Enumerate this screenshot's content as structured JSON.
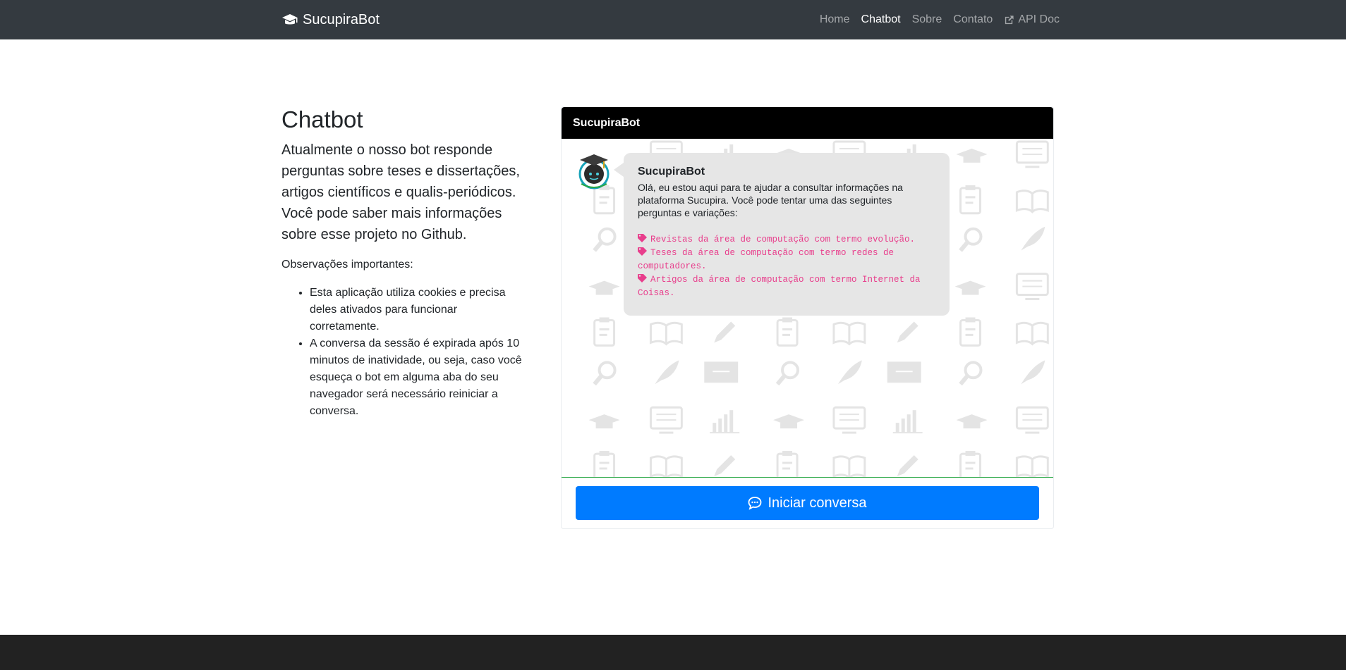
{
  "navbar": {
    "brand": "SucupiraBot",
    "items": [
      {
        "label": "Home",
        "active": false
      },
      {
        "label": "Chatbot",
        "active": true
      },
      {
        "label": "Sobre",
        "active": false
      },
      {
        "label": "Contato",
        "active": false
      },
      {
        "label": "API Doc",
        "active": false,
        "icon": "external-link-icon"
      }
    ]
  },
  "intro": {
    "title": "Chatbot",
    "lead": "Atualmente o nosso bot responde perguntas sobre teses e dissertações, artigos científicos e qualis-periódicos. Você pode saber mais informações sobre esse projeto no Github.",
    "notes_title": "Observações importantes:",
    "notes": [
      "Esta aplicação utiliza cookies e precisa deles ativados para funcionar corretamente.",
      "A conversa da sessão é expirada após 10 minutos de inatividade, ou seja, caso você esqueça o bot em alguma aba do seu navegador será necessário reiniciar a conversa."
    ]
  },
  "chat": {
    "header": "SucupiraBot",
    "message": {
      "sender": "SucupiraBot",
      "text": "Olá, eu estou aqui para te ajudar a consultar informações na plataforma Sucupira. Você pode tentar uma das seguintes perguntas e variações:",
      "suggestions": [
        "Revistas da área de computação com termo evolução.",
        "Teses da área de computação com termo redes de computadores.",
        "Artigos da área de computação com termo Internet da Coisas."
      ]
    },
    "start_button": "Iniciar conversa"
  },
  "colors": {
    "navbar": "#343a40",
    "primary": "#007bff",
    "suggestion": "#e83e8c",
    "bubble": "#e6e6e6",
    "footer": "#222222"
  }
}
